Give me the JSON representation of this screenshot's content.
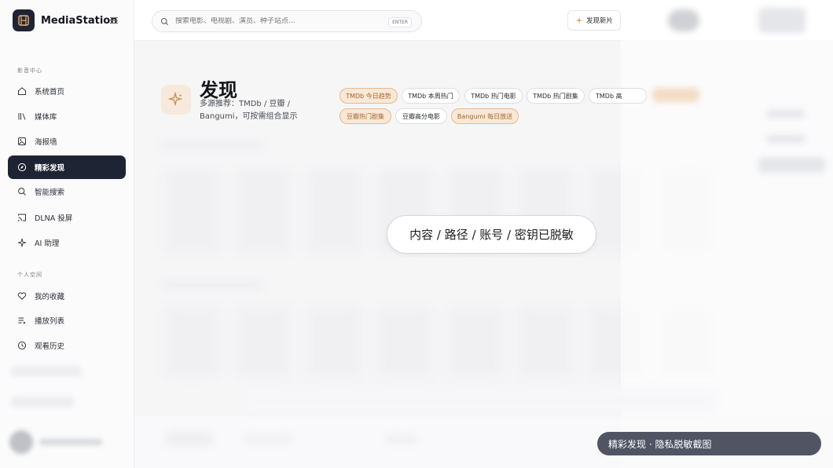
{
  "app": {
    "name": "MediaStation"
  },
  "sidebar": {
    "section_media": "影音中心",
    "section_personal": "个人空间",
    "items": [
      {
        "label": "系统首页",
        "icon": "home-icon"
      },
      {
        "label": "媒体库",
        "icon": "library-icon"
      },
      {
        "label": "海报墙",
        "icon": "image-icon"
      },
      {
        "label": "精彩发现",
        "icon": "compass-icon",
        "active": true
      },
      {
        "label": "智能搜索",
        "icon": "search-icon"
      },
      {
        "label": "DLNA 投屏",
        "icon": "cast-icon"
      },
      {
        "label": "AI 助理",
        "icon": "sparkle-icon"
      }
    ],
    "personal_items": [
      {
        "label": "我的收藏",
        "icon": "heart-icon"
      },
      {
        "label": "播放列表",
        "icon": "playlist-icon"
      },
      {
        "label": "观看历史",
        "icon": "history-icon"
      }
    ]
  },
  "search": {
    "placeholder": "搜索电影、电视剧、演员、种子站点...",
    "shortcut": "ENTER"
  },
  "header": {
    "new_button": "发现新片"
  },
  "page": {
    "title": "发现",
    "subtitle": "多源推荐：TMDb / 豆瓣 / Bangumi，可按需组合显示"
  },
  "chips": [
    {
      "label": "TMDb 今日趋势",
      "selected": true
    },
    {
      "label": "TMDb 本周热门",
      "selected": false
    },
    {
      "label": "TMDb 热门电影",
      "selected": false
    },
    {
      "label": "TMDb 热门剧集",
      "selected": false
    },
    {
      "label": "TMDb 高",
      "selected": false
    },
    {
      "label": "豆瓣热门剧集",
      "selected": true
    },
    {
      "label": "豆瓣高分电影",
      "selected": false
    },
    {
      "label": "Bangumi 每日放送",
      "selected": true
    }
  ],
  "overlay": {
    "redaction_notice": "内容 / 路径 / 账号 / 密钥已脱敏"
  },
  "caption": "精彩发现 · 隐私脱敏截图",
  "colors": {
    "accent": "#1e2433",
    "highlight_bg": "#f9e8d6",
    "highlight_text": "#a8642b"
  }
}
